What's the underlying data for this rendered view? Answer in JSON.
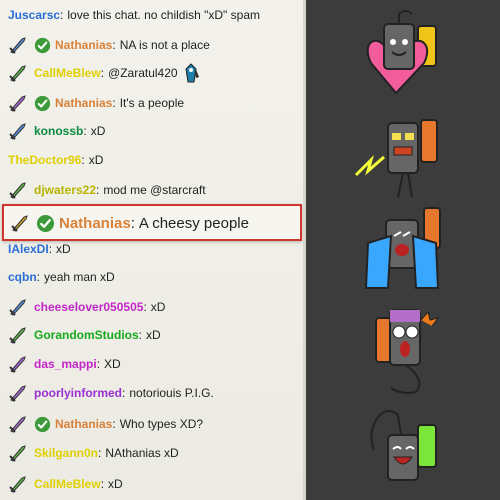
{
  "chat": {
    "messages": [
      {
        "user": "Juscarsc",
        "color": "#2b6fd6",
        "badge": "none",
        "check": false,
        "text": "love this chat. no childish \"xD\" spam"
      },
      {
        "user": "Nathanias",
        "color": "#d8823a",
        "badge": "blue-sword-icon",
        "check": true,
        "text": "NA is not a place"
      },
      {
        "user": "CallMeBlew",
        "color": "#e0d000",
        "badge": "green-sword-icon",
        "check": false,
        "text": "@Zaratul420",
        "emote": true
      },
      {
        "user": "Nathanias",
        "color": "#d8823a",
        "badge": "purple-sword-icon",
        "check": true,
        "text": "It's a people"
      },
      {
        "user": "konossb",
        "color": "#0a8a3c",
        "badge": "blue-sword-icon",
        "check": false,
        "text": "xD"
      },
      {
        "user": "TheDoctor96",
        "color": "#e0d000",
        "badge": "none",
        "check": false,
        "text": "xD"
      },
      {
        "user": "djwaters22",
        "color": "#b8b400",
        "badge": "green-sword-icon",
        "check": false,
        "text": "mod me @starcraft"
      },
      {
        "user": "IAlexDI",
        "color": "#2b6fd6",
        "badge": "none",
        "check": false,
        "text": "xD"
      },
      {
        "user": "cqbn",
        "color": "#2b6fd6",
        "badge": "none",
        "check": false,
        "text": "yeah man xD"
      },
      {
        "user": "cheeselover050505",
        "color": "#c326c8",
        "badge": "blue-sword-icon",
        "check": false,
        "text": "xD"
      },
      {
        "user": "GorandomStudios",
        "color": "#17a81d",
        "badge": "green-sword-icon",
        "check": false,
        "text": "xD"
      },
      {
        "user": "das_mappi",
        "color": "#c326c8",
        "badge": "purple-sword-icon",
        "check": false,
        "text": "XD"
      },
      {
        "user": "poorlyinformed",
        "color": "#9a30d0",
        "badge": "purple-sword-icon",
        "check": false,
        "text": "notoriouis P.I.G."
      },
      {
        "user": "Nathanias",
        "color": "#d8823a",
        "badge": "purple-sword-icon",
        "check": true,
        "text": "Who types XD?"
      },
      {
        "user": "Skilgann0n",
        "color": "#e0d000",
        "badge": "green-sword-icon",
        "check": false,
        "text": "NAthanias xD"
      },
      {
        "user": "CallMeBlew",
        "color": "#e0d000",
        "badge": "green-sword-icon",
        "check": false,
        "text": "xD"
      }
    ],
    "highlight": {
      "user": "Nathanias",
      "color": "#d8823a",
      "text": "A cheesy people"
    }
  },
  "stickers": [
    {
      "name": "battery-hugging-heart-sticker"
    },
    {
      "name": "battery-angry-sparks-sticker"
    },
    {
      "name": "battery-crying-sticker"
    },
    {
      "name": "battery-shocked-sticker"
    },
    {
      "name": "battery-laughing-sticker"
    }
  ],
  "colors": {
    "chat_bg": "#f0efe8",
    "panel_bg": "#3c3c3c",
    "highlight_border": "#d0342c",
    "check_green": "#3d9a3a"
  }
}
